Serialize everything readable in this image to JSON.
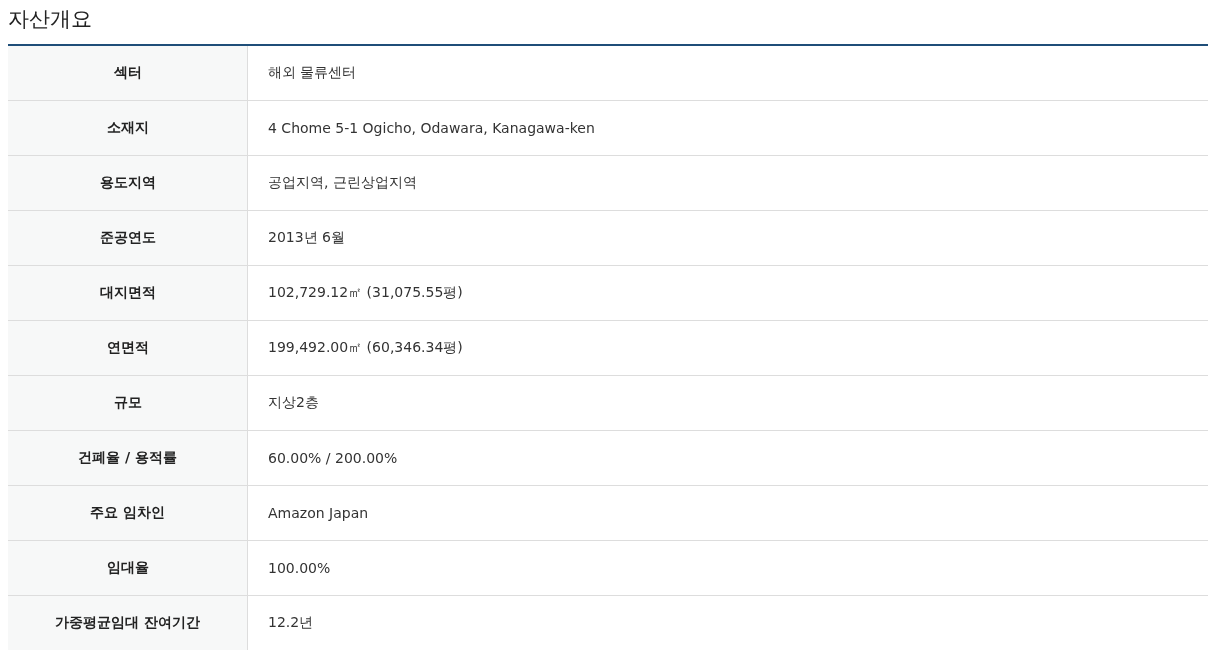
{
  "title": "자산개요",
  "rows": [
    {
      "label": "섹터",
      "value": "해외 물류센터"
    },
    {
      "label": "소재지",
      "value": "4 Chome 5-1 Ogicho, Odawara, Kanagawa-ken"
    },
    {
      "label": "용도지역",
      "value": "공업지역, 근린상업지역"
    },
    {
      "label": "준공연도",
      "value": "2013년 6월"
    },
    {
      "label": "대지면적",
      "value": "102,729.12㎡ (31,075.55평)"
    },
    {
      "label": "연면적",
      "value": "199,492.00㎡ (60,346.34평)"
    },
    {
      "label": "규모",
      "value": "지상2층"
    },
    {
      "label": "건폐율 / 용적률",
      "value": "60.00% / 200.00%"
    },
    {
      "label": "주요 임차인",
      "value": "Amazon Japan"
    },
    {
      "label": "임대율",
      "value": "100.00%"
    },
    {
      "label": "가중평균임대 잔여기간",
      "value": "12.2년"
    }
  ]
}
